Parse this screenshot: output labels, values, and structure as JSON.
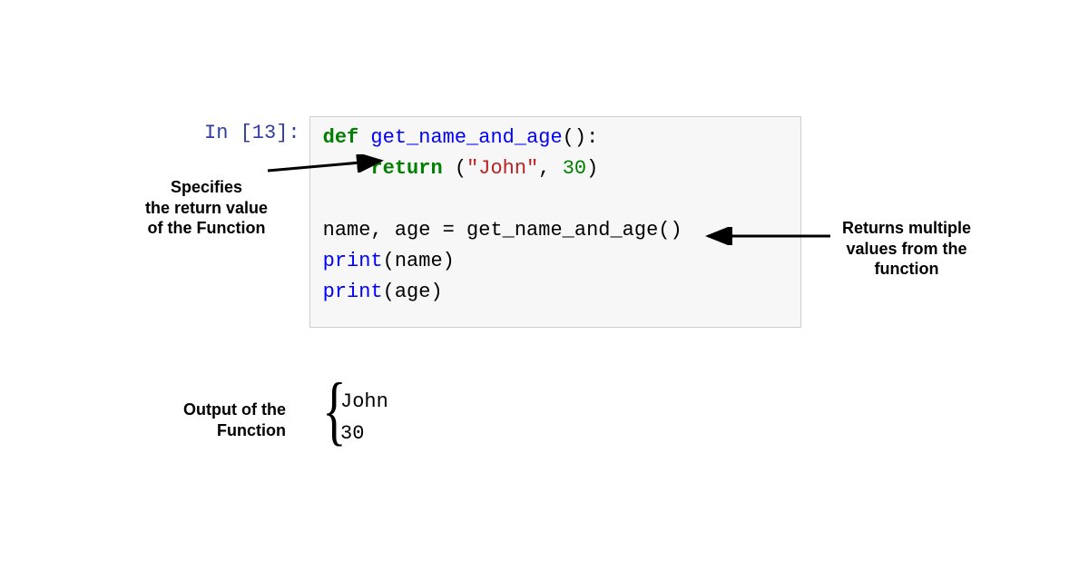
{
  "prompt": "In [13]:",
  "code": {
    "line1": {
      "def": "def",
      "fn": " get_name_and_age",
      "paren": "():"
    },
    "line2": {
      "indent": "    ",
      "ret": "return",
      "open": " (",
      "str": "\"John\"",
      "comma": ", ",
      "num": "30",
      "close": ")"
    },
    "line3": {
      "text": "name, age = get_name_and_age()"
    },
    "line4": {
      "print": "print",
      "arg": "(name)"
    },
    "line5": {
      "print": "print",
      "arg": "(age)"
    }
  },
  "output": {
    "line1": "John",
    "line2": "30"
  },
  "annotations": {
    "left": "Specifies\nthe return value\nof the Function",
    "right": "Returns multiple\nvalues from the\nfunction",
    "output": "Output of the\nFunction"
  }
}
